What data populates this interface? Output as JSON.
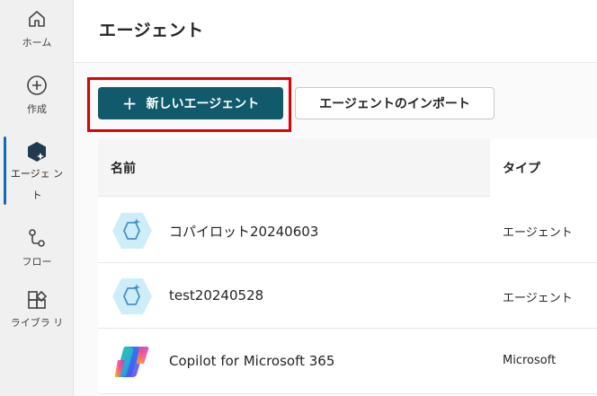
{
  "nav": {
    "items": [
      {
        "label": "ホーム",
        "icon": "home-icon"
      },
      {
        "label": "作成",
        "icon": "add-circle-icon"
      },
      {
        "label": "エージェ ント",
        "icon": "agent-icon",
        "active": true
      },
      {
        "label": "フロー",
        "icon": "flow-icon"
      },
      {
        "label": "ライブラ リ",
        "icon": "library-icon"
      }
    ]
  },
  "header": {
    "title": "エージェント"
  },
  "toolbar": {
    "new_agent_label": "新しいエージェント",
    "import_label": "エージェントのインポート",
    "highlight_color": "#e00000",
    "primary_color": "#115a6b"
  },
  "table": {
    "columns": [
      "名前",
      "タイプ"
    ],
    "rows": [
      {
        "name": "コパイロット20240603",
        "type": "エージェント",
        "icon": "agent-hexagon-icon"
      },
      {
        "name": "test20240528",
        "type": "エージェント",
        "icon": "agent-hexagon-icon"
      },
      {
        "name": "Copilot for Microsoft 365",
        "type": "Microsoft",
        "icon": "copilot-logo-icon"
      }
    ]
  }
}
